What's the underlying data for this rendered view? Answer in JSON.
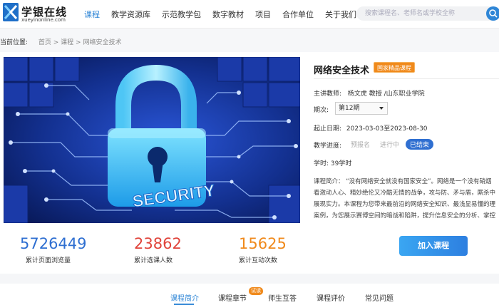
{
  "header": {
    "logo_name": "学银在线",
    "logo_sub": "xueyinonline.com",
    "nav": [
      "课程",
      "教学资源库",
      "示范教学包",
      "数字教材",
      "项目",
      "合作单位",
      "关于我们"
    ],
    "active_nav": "课程",
    "search_placeholder": "搜索课程名、老师名或学校全称",
    "accent": "#2f86d6"
  },
  "breadcrumb": {
    "label": "当前位置:",
    "path": "首页 > 课程 > 网络安全技术"
  },
  "course": {
    "title": "网络安全技术",
    "badge": "国家精品课程",
    "cover_text": "SECURITY",
    "teacher_label": "主讲教师:",
    "teacher_value": "杨文虎 教授 /山东职业学院",
    "term_label": "期次:",
    "term_value": "第12期",
    "dates_label": "起止日期:",
    "dates_value": "2023-03-03至2023-08-30",
    "progress_label": "教学进度:",
    "progress_states": [
      "预报名",
      "进行中",
      "已结束"
    ],
    "hours_label": "学时:",
    "hours_value": "39学时",
    "intro_lines": [
      "课程简介：  “没有网络安全就没有国家安全”。网络是一个没有硝烟",
      "看激动人心、精妙绝伦又冷酷无情的战争，攻与防、矛与盾，厮杀中",
      "展现实力。本课程为您带来最前沿的网络安全知识、最浅显易懂的理",
      "案例，为您展示赛博空间的暗战和陷阱，提升信息安全的分析、掌控"
    ]
  },
  "stats": [
    {
      "value": "5726449",
      "label": "累计页面浏览量",
      "color": "#2f6fd1"
    },
    {
      "value": "23862",
      "label": "累计选课人数",
      "color": "#e0443b"
    },
    {
      "value": "15625",
      "label": "累计互动次数",
      "color": "#f08a1c"
    }
  ],
  "join_label": "加入课程",
  "tabs": [
    "课程简介",
    "课程章节",
    "师生互答",
    "课程评价",
    "常见问题"
  ],
  "trial_badge": "试读"
}
